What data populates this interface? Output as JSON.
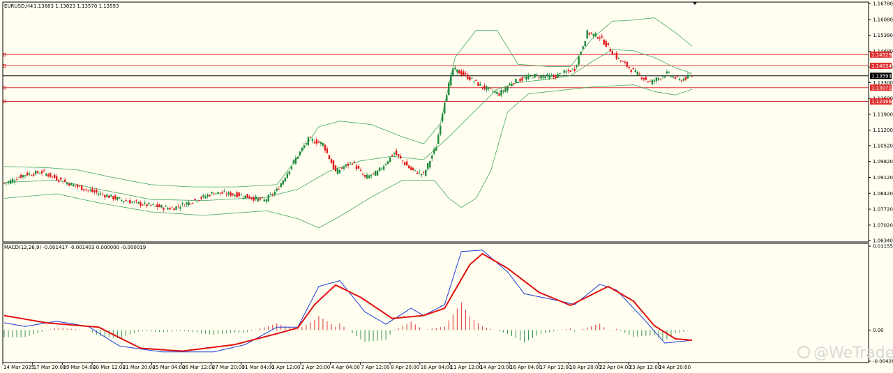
{
  "header": {
    "symbol": "EURUSD,H4",
    "ohlc": "1.13683 1.13823 1.13570 1.13593"
  },
  "macd": {
    "label": "MACD(12,26,9) -0.001417 -0.001403 0.000000 -0.000019",
    "axis_labels": [
      "0.011553",
      "0.00",
      "-0.004281"
    ]
  },
  "watermark": "@WeTrade",
  "colors": {
    "background": "#fffef0",
    "bull": "#1e8a3a",
    "bear": "#e0191b",
    "bands": "#45a85c",
    "level": "#e03030",
    "current": "#000000",
    "macd_line": "#1f3bd6",
    "signal_line": "#e01010"
  },
  "chart_data": {
    "type": "candlestick",
    "x_tick_labels": [
      "14 Mar 2025",
      "17 Mar 20:00",
      "19 Mar 04:00",
      "20 Mar 12:00",
      "21 Mar 20:00",
      "25 Mar 04:00",
      "26 Mar 12:00",
      "27 Mar 20:00",
      "31 Mar 04:00",
      "1 Apr 12:00",
      "2 Apr 20:00",
      "4 Apr 04:00",
      "7 Apr 12:00",
      "8 Apr 20:00",
      "10 Apr 04:00",
      "11 Apr 12:00",
      "14 Apr 20:00",
      "16 Apr 04:00",
      "17 Apr 12:00",
      "18 Apr 20:00",
      "22 Apr 04:00",
      "23 Apr 12:00",
      "24 Apr 20:00"
    ],
    "price_axis": [
      "1.16780",
      "1.16080",
      "1.15380",
      "1.14680",
      "1.13980",
      "1.13300",
      "1.12600",
      "1.11900",
      "1.11200",
      "1.10520",
      "1.09820",
      "1.09120",
      "1.08420",
      "1.07720",
      "1.07020",
      "1.06340"
    ],
    "price_range": [
      1.0634,
      1.1678
    ],
    "levels": [
      {
        "price": 1.14529,
        "label": "1.14529"
      },
      {
        "price": 1.14034,
        "label": "1.14034"
      },
      {
        "price": 1.13071,
        "label": "1.13071"
      },
      {
        "price": 1.12466,
        "label": "1.12466"
      }
    ],
    "current_price": {
      "price": 1.13593,
      "label": "1.13593"
    },
    "close_anchors": [
      [
        0,
        1.0885
      ],
      [
        10,
        1.0925
      ],
      [
        18,
        1.0935
      ],
      [
        28,
        1.0895
      ],
      [
        40,
        1.0855
      ],
      [
        55,
        1.0815
      ],
      [
        68,
        1.079
      ],
      [
        80,
        1.0775
      ],
      [
        92,
        1.0815
      ],
      [
        100,
        1.0845
      ],
      [
        112,
        1.0835
      ],
      [
        124,
        1.081
      ],
      [
        130,
        1.0855
      ],
      [
        138,
        1.098
      ],
      [
        145,
        1.108
      ],
      [
        152,
        1.106
      ],
      [
        158,
        1.0935
      ],
      [
        166,
        1.098
      ],
      [
        172,
        1.091
      ],
      [
        178,
        1.0935
      ],
      [
        186,
        1.102
      ],
      [
        194,
        1.0945
      ],
      [
        200,
        1.0925
      ],
      [
        206,
        1.105
      ],
      [
        210,
        1.125
      ],
      [
        214,
        1.139
      ],
      [
        220,
        1.136
      ],
      [
        228,
        1.131
      ],
      [
        236,
        1.128
      ],
      [
        242,
        1.133
      ],
      [
        252,
        1.136
      ],
      [
        262,
        1.1355
      ],
      [
        272,
        1.139
      ],
      [
        278,
        1.155
      ],
      [
        284,
        1.153
      ],
      [
        292,
        1.144
      ],
      [
        300,
        1.138
      ],
      [
        308,
        1.133
      ],
      [
        316,
        1.137
      ],
      [
        322,
        1.134
      ],
      [
        328,
        1.1359
      ]
    ],
    "bb_upper": [
      [
        0,
        1.096
      ],
      [
        20,
        1.0955
      ],
      [
        35,
        1.0945
      ],
      [
        50,
        1.0915
      ],
      [
        70,
        1.088
      ],
      [
        90,
        1.087
      ],
      [
        110,
        1.087
      ],
      [
        130,
        1.088
      ],
      [
        140,
        1.1
      ],
      [
        150,
        1.1135
      ],
      [
        160,
        1.116
      ],
      [
        175,
        1.1145
      ],
      [
        190,
        1.109
      ],
      [
        200,
        1.106
      ],
      [
        208,
        1.115
      ],
      [
        215,
        1.144
      ],
      [
        225,
        1.156
      ],
      [
        235,
        1.156
      ],
      [
        245,
        1.141
      ],
      [
        260,
        1.14
      ],
      [
        270,
        1.14
      ],
      [
        280,
        1.152
      ],
      [
        290,
        1.16
      ],
      [
        300,
        1.1605
      ],
      [
        310,
        1.1615
      ],
      [
        320,
        1.155
      ],
      [
        328,
        1.149
      ]
    ],
    "bb_middle": [
      [
        0,
        1.089
      ],
      [
        25,
        1.09
      ],
      [
        45,
        1.086
      ],
      [
        70,
        1.0815
      ],
      [
        95,
        1.081
      ],
      [
        125,
        1.0825
      ],
      [
        140,
        1.086
      ],
      [
        155,
        1.094
      ],
      [
        170,
        1.0985
      ],
      [
        185,
        1.1005
      ],
      [
        200,
        1.099
      ],
      [
        212,
        1.109
      ],
      [
        225,
        1.121
      ],
      [
        235,
        1.13
      ],
      [
        245,
        1.133
      ],
      [
        260,
        1.1345
      ],
      [
        270,
        1.136
      ],
      [
        280,
        1.142
      ],
      [
        290,
        1.1475
      ],
      [
        300,
        1.147
      ],
      [
        310,
        1.144
      ],
      [
        320,
        1.1395
      ],
      [
        328,
        1.137
      ]
    ],
    "bb_lower": [
      [
        0,
        1.082
      ],
      [
        25,
        1.084
      ],
      [
        45,
        1.08
      ],
      [
        70,
        1.076
      ],
      [
        95,
        1.0745
      ],
      [
        125,
        1.0765
      ],
      [
        140,
        1.073
      ],
      [
        150,
        1.069
      ],
      [
        160,
        1.074
      ],
      [
        175,
        1.0825
      ],
      [
        190,
        1.09
      ],
      [
        205,
        1.09
      ],
      [
        212,
        1.082
      ],
      [
        218,
        1.078
      ],
      [
        225,
        1.082
      ],
      [
        232,
        1.094
      ],
      [
        240,
        1.12
      ],
      [
        250,
        1.128
      ],
      [
        260,
        1.129
      ],
      [
        270,
        1.13
      ],
      [
        280,
        1.131
      ],
      [
        290,
        1.1315
      ],
      [
        300,
        1.132
      ],
      [
        310,
        1.129
      ],
      [
        320,
        1.1275
      ],
      [
        328,
        1.13
      ]
    ],
    "macd_range": [
      -0.004281,
      0.011553
    ],
    "macd_line": [
      [
        0,
        0.001
      ],
      [
        10,
        0.0005
      ],
      [
        25,
        0.0012
      ],
      [
        40,
        0.0005
      ],
      [
        55,
        -0.0022
      ],
      [
        75,
        -0.003
      ],
      [
        100,
        -0.003
      ],
      [
        115,
        -0.002
      ],
      [
        130,
        0.0004
      ],
      [
        140,
        0.0004
      ],
      [
        150,
        0.006
      ],
      [
        160,
        0.0068
      ],
      [
        172,
        0.0025
      ],
      [
        182,
        0.0008
      ],
      [
        194,
        0.003
      ],
      [
        200,
        0.002
      ],
      [
        210,
        0.0035
      ],
      [
        218,
        0.0108
      ],
      [
        228,
        0.011
      ],
      [
        240,
        0.008
      ],
      [
        248,
        0.005
      ],
      [
        265,
        0.004
      ],
      [
        272,
        0.0035
      ],
      [
        284,
        0.0063
      ],
      [
        292,
        0.0055
      ],
      [
        305,
        0.0015
      ],
      [
        315,
        -0.0018
      ],
      [
        328,
        -0.0014
      ]
    ],
    "signal_line": [
      [
        0,
        0.002
      ],
      [
        20,
        0.001
      ],
      [
        45,
        0.0004
      ],
      [
        65,
        -0.0025
      ],
      [
        85,
        -0.0029
      ],
      [
        110,
        -0.002
      ],
      [
        130,
        -0.0005
      ],
      [
        140,
        0.0003
      ],
      [
        148,
        0.0035
      ],
      [
        158,
        0.0062
      ],
      [
        170,
        0.0045
      ],
      [
        185,
        0.0016
      ],
      [
        200,
        0.002
      ],
      [
        210,
        0.003
      ],
      [
        222,
        0.009
      ],
      [
        228,
        0.0105
      ],
      [
        240,
        0.0085
      ],
      [
        255,
        0.0052
      ],
      [
        270,
        0.0034
      ],
      [
        288,
        0.006
      ],
      [
        300,
        0.004
      ],
      [
        310,
        0.0006
      ],
      [
        320,
        -0.0012
      ],
      [
        328,
        -0.0014
      ]
    ]
  }
}
